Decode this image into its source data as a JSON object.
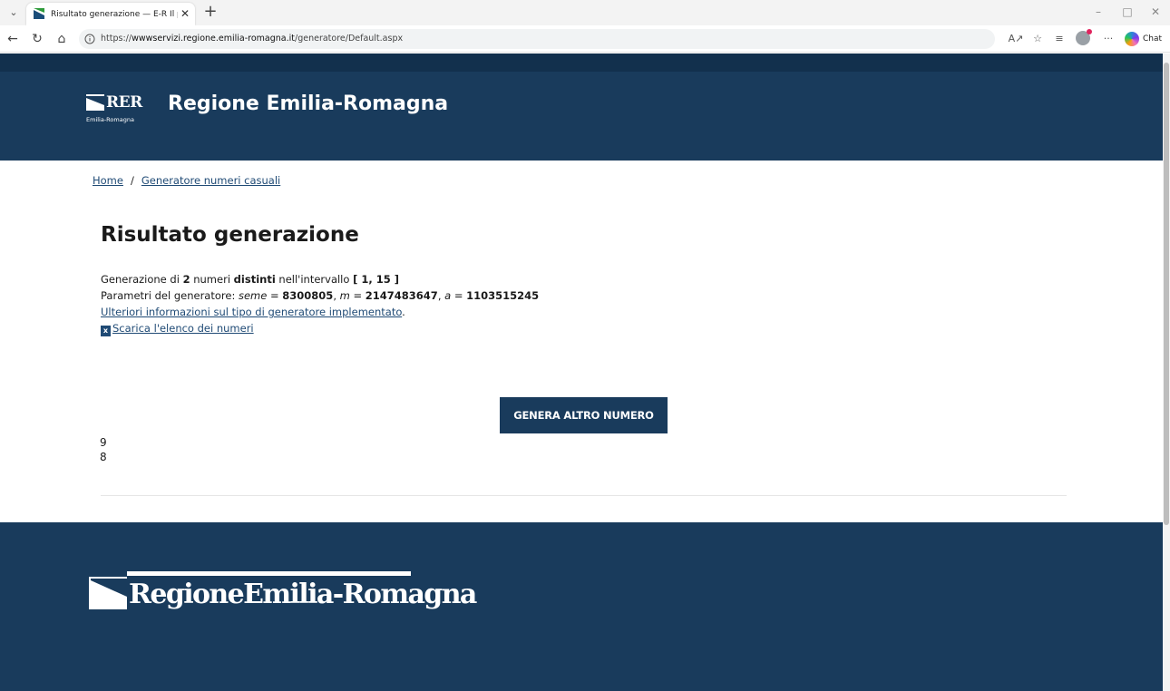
{
  "browser": {
    "tab_title": "Risultato generazione — E-R Il por",
    "url_prefix": "https://",
    "url_host": "wwwservizi.regione.emilia-romagna.it",
    "url_path": "/generatore/Default.aspx",
    "chat_label": "Chat"
  },
  "header": {
    "logo_text": "RER",
    "logo_subtext": "Emilia-Romagna",
    "site_title": "Regione Emilia-Romagna"
  },
  "breadcrumb": {
    "home": "Home",
    "separator": "/",
    "current": "Generatore numeri casuali"
  },
  "main": {
    "title": "Risultato generazione",
    "summary": {
      "prefix": "Generazione di ",
      "count": "2",
      "mid1": " numeri ",
      "kind": "distinti",
      "mid2": " nell'intervallo ",
      "interval": "[ 1, 15 ]"
    },
    "params": {
      "label": "Parametri del generatore: ",
      "seed_name": "seme",
      "eq": " = ",
      "seed_value": "8300805",
      "m_name": "m",
      "m_value": "2147483647",
      "a_name": "a",
      "a_value": "1103515245",
      "comma": ", "
    },
    "info_link": "Ulteriori informazioni sul tipo di generatore implementato",
    "info_link_suffix": ".",
    "download_icon_text": "x",
    "download_link": "Scarica l'elenco dei numeri",
    "generate_button": "GENERA ALTRO NUMERO",
    "results": [
      "9",
      "8"
    ]
  },
  "footer": {
    "logo_text": "RegioneEmilia-Romagna"
  },
  "colors": {
    "header_bg": "#193b5c",
    "header_top_bg": "#12304d",
    "link": "#1f4a75",
    "button_bg": "#193b5c"
  }
}
